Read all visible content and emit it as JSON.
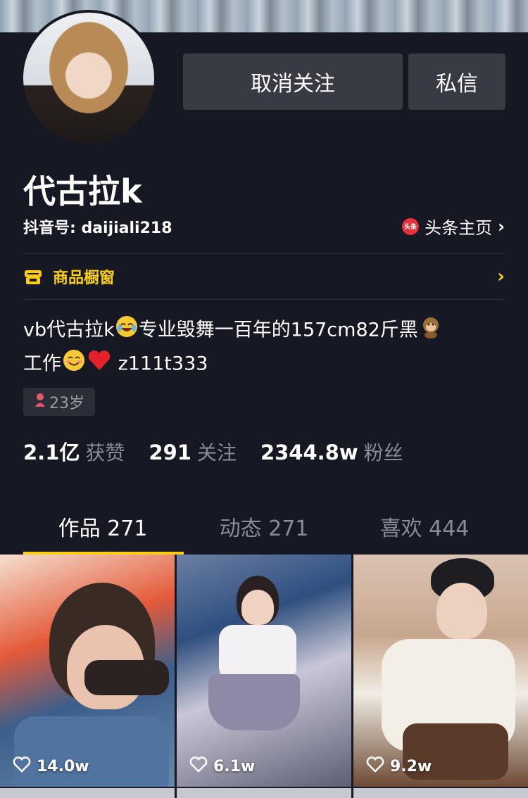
{
  "profile": {
    "name": "代古拉k",
    "douyin_id": "抖音号: daijiali218",
    "toutiao_badge": "头条",
    "toutiao_link": "头条主页",
    "age": "23岁",
    "bio_line1_a": "vb代古拉k",
    "bio_line1_b": "专业毁舞一百年的157cm82斤黑",
    "bio_line2_a": "工作",
    "bio_line2_b": "z111t333"
  },
  "actions": {
    "unfollow_label": "取消关注",
    "message_label": "私信"
  },
  "shop": {
    "label": "商品橱窗"
  },
  "stats": [
    {
      "value": "2.1亿",
      "label": "获赞"
    },
    {
      "value": "291",
      "label": "关注"
    },
    {
      "value": "2344.8w",
      "label": "粉丝"
    }
  ],
  "tabs": [
    {
      "label": "作品 271"
    },
    {
      "label": "动态 271"
    },
    {
      "label": "喜欢 444"
    }
  ],
  "videos": [
    {
      "likes": "14.0w"
    },
    {
      "likes": "6.1w"
    },
    {
      "likes": "9.2w"
    }
  ],
  "colors": {
    "background": "#161823",
    "accent": "#face15",
    "button": "#393b44",
    "muted_text": "#8a8c95"
  },
  "icons": [
    "heart-icon",
    "shop-icon",
    "toutiao-icon",
    "chevron-right-icon",
    "female-icon"
  ]
}
